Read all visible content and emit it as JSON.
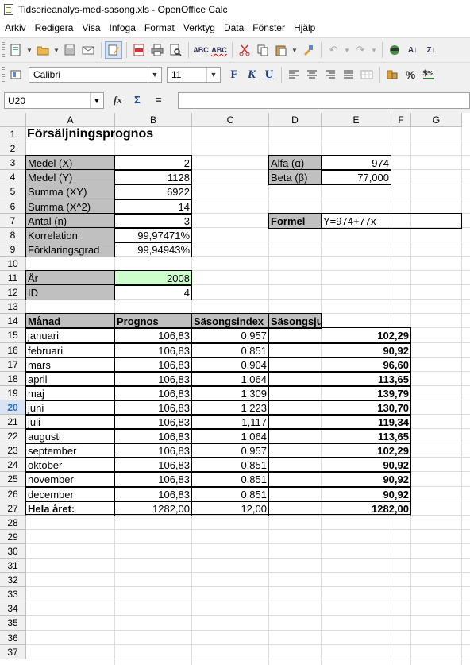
{
  "window": {
    "title": "Tidserieanalys-med-sasong.xls - OpenOffice Calc"
  },
  "menu": [
    "Arkiv",
    "Redigera",
    "Visa",
    "Infoga",
    "Format",
    "Verktyg",
    "Data",
    "Fönster",
    "Hjälp"
  ],
  "toolbar2": {
    "font_name": "Calibri",
    "font_size": "11",
    "bold": "F",
    "italic": "K",
    "underline": "U",
    "percent": "%"
  },
  "formula_bar": {
    "name_box": "U20",
    "fx": "fx",
    "sum": "Σ",
    "equals": "=",
    "content": ""
  },
  "columns": [
    "A",
    "B",
    "C",
    "D",
    "E",
    "F",
    "G"
  ],
  "rows": [
    "1",
    "2",
    "3",
    "4",
    "5",
    "6",
    "7",
    "8",
    "9",
    "10",
    "11",
    "12",
    "13",
    "14",
    "15",
    "16",
    "17",
    "18",
    "19",
    "20",
    "21",
    "22",
    "23",
    "24",
    "25",
    "26",
    "27",
    "28",
    "29",
    "30",
    "31",
    "32",
    "33",
    "34",
    "35",
    "36",
    "37"
  ],
  "active_row": "20",
  "sheet": {
    "title": "Försäljningsprognos",
    "stats": [
      {
        "label": "Medel (X)",
        "value": "2"
      },
      {
        "label": "Medel (Y)",
        "value": "1128"
      },
      {
        "label": "Summa (XY)",
        "value": "6922"
      },
      {
        "label": "Summa (X^2)",
        "value": "14"
      },
      {
        "label": "Antal (n)",
        "value": "3"
      },
      {
        "label": "Korrelation",
        "value": "99,97471%"
      },
      {
        "label": "Förklaringsgrad",
        "value": "99,94943%"
      }
    ],
    "params": [
      {
        "label": "Alfa (α)",
        "value": "974"
      },
      {
        "label": "Beta (β)",
        "value": "77,000"
      }
    ],
    "formula": {
      "label": "Formel",
      "value": "Y=974+77x"
    },
    "year": {
      "label": "År",
      "value": "2008"
    },
    "id": {
      "label": "ID",
      "value": "4"
    },
    "table_headers": [
      "Månad",
      "Prognos",
      "Säsongsindex",
      "Säsongsjusterad prognos"
    ],
    "table_rows": [
      {
        "month": "januari",
        "forecast": "106,83",
        "index": "0,957",
        "adjusted": "102,29"
      },
      {
        "month": "februari",
        "forecast": "106,83",
        "index": "0,851",
        "adjusted": "90,92"
      },
      {
        "month": "mars",
        "forecast": "106,83",
        "index": "0,904",
        "adjusted": "96,60"
      },
      {
        "month": "april",
        "forecast": "106,83",
        "index": "1,064",
        "adjusted": "113,65"
      },
      {
        "month": "maj",
        "forecast": "106,83",
        "index": "1,309",
        "adjusted": "139,79"
      },
      {
        "month": "juni",
        "forecast": "106,83",
        "index": "1,223",
        "adjusted": "130,70"
      },
      {
        "month": "juli",
        "forecast": "106,83",
        "index": "1,117",
        "adjusted": "119,34"
      },
      {
        "month": "augusti",
        "forecast": "106,83",
        "index": "1,064",
        "adjusted": "113,65"
      },
      {
        "month": "september",
        "forecast": "106,83",
        "index": "0,957",
        "adjusted": "102,29"
      },
      {
        "month": "oktober",
        "forecast": "106,83",
        "index": "0,851",
        "adjusted": "90,92"
      },
      {
        "month": "november",
        "forecast": "106,83",
        "index": "0,851",
        "adjusted": "90,92"
      },
      {
        "month": "december",
        "forecast": "106,83",
        "index": "0,851",
        "adjusted": "90,92"
      }
    ],
    "total": {
      "month": "Hela året:",
      "forecast": "1282,00",
      "index": "12,00",
      "adjusted": "1282,00"
    }
  }
}
